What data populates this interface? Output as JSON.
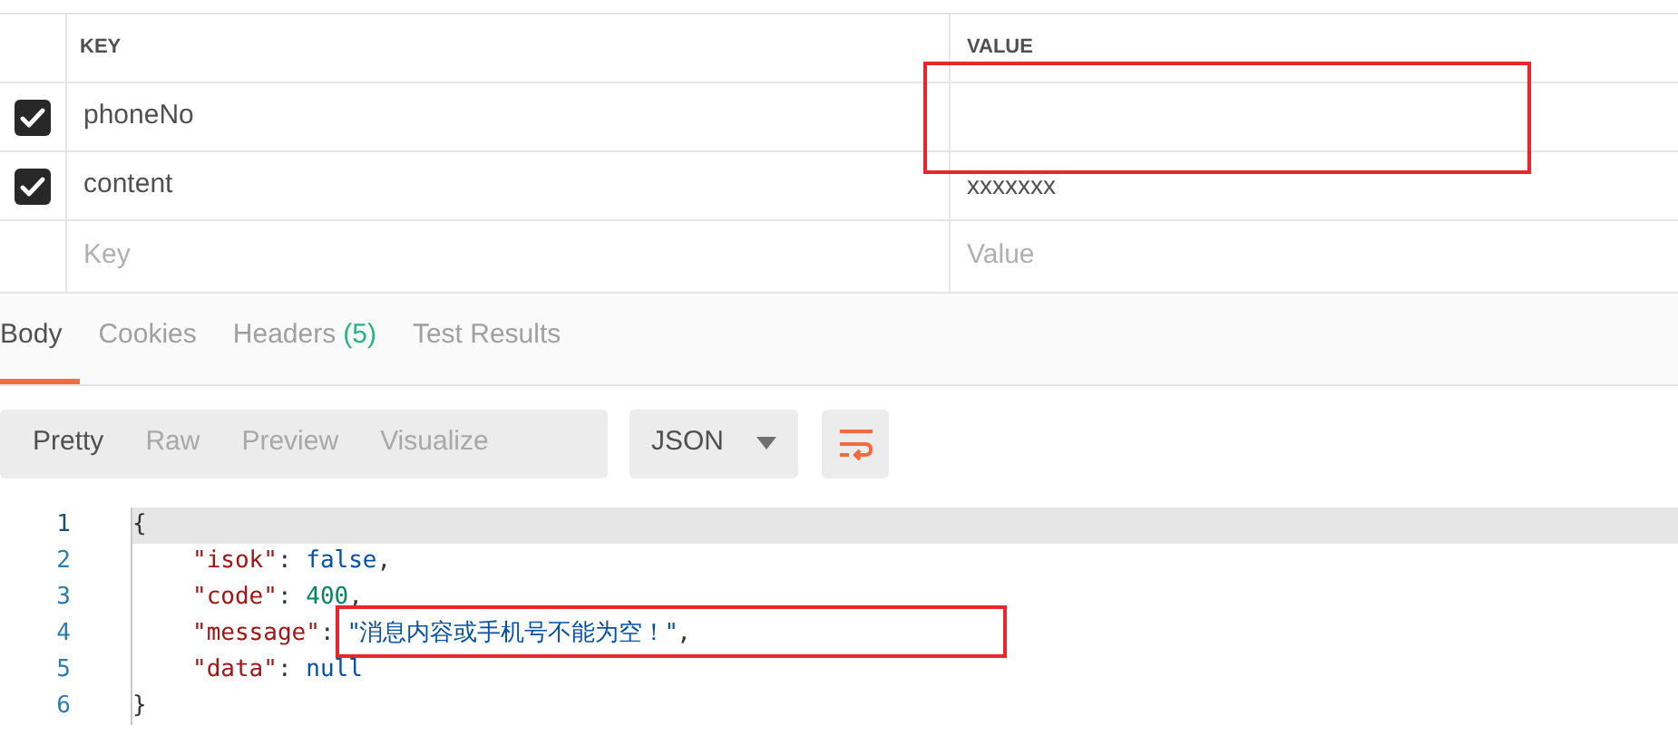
{
  "params_table": {
    "columns": [
      "KEY",
      "VALUE"
    ],
    "rows": [
      {
        "checked": true,
        "key": "phoneNo",
        "value": ""
      },
      {
        "checked": true,
        "key": "content",
        "value": "xxxxxxx"
      }
    ],
    "new_row": {
      "key_placeholder": "Key",
      "value_placeholder": "Value"
    }
  },
  "response_tabs": [
    {
      "label": "Body",
      "selected": true
    },
    {
      "label": "Cookies",
      "selected": false
    },
    {
      "label": "Headers",
      "count": "(5)",
      "selected": false
    },
    {
      "label": "Test Results",
      "selected": false
    }
  ],
  "view_modes": [
    {
      "label": "Pretty",
      "selected": true
    },
    {
      "label": "Raw",
      "selected": false
    },
    {
      "label": "Preview",
      "selected": false
    },
    {
      "label": "Visualize",
      "selected": false
    }
  ],
  "format_select": {
    "value": "JSON"
  },
  "code": [
    {
      "number": "1",
      "kind": "brace",
      "active": true,
      "tokens": [
        {
          "kind": "punct",
          "text": "{"
        }
      ]
    },
    {
      "number": "2",
      "kind": "member",
      "active": false,
      "tokens": [
        {
          "kind": "key",
          "text": "\"isok\""
        },
        {
          "kind": "punct",
          "text": ": "
        },
        {
          "kind": "bool",
          "text": "false"
        },
        {
          "kind": "punct",
          "text": ","
        }
      ]
    },
    {
      "number": "3",
      "kind": "member",
      "active": false,
      "tokens": [
        {
          "kind": "key",
          "text": "\"code\""
        },
        {
          "kind": "punct",
          "text": ": "
        },
        {
          "kind": "number",
          "text": "400"
        },
        {
          "kind": "punct",
          "text": ","
        }
      ]
    },
    {
      "number": "4",
      "kind": "member",
      "active": false,
      "tokens": [
        {
          "kind": "key",
          "text": "\"message\""
        },
        {
          "kind": "punct",
          "text": ": "
        },
        {
          "kind": "string",
          "text": "\"消息内容或手机号不能为空！\""
        },
        {
          "kind": "punct",
          "text": ","
        }
      ]
    },
    {
      "number": "5",
      "kind": "member",
      "active": false,
      "tokens": [
        {
          "kind": "key",
          "text": "\"data\""
        },
        {
          "kind": "punct",
          "text": ": "
        },
        {
          "kind": "null",
          "text": "null"
        }
      ]
    },
    {
      "number": "6",
      "kind": "brace",
      "active": false,
      "tokens": [
        {
          "kind": "punct",
          "text": "}"
        }
      ]
    }
  ]
}
